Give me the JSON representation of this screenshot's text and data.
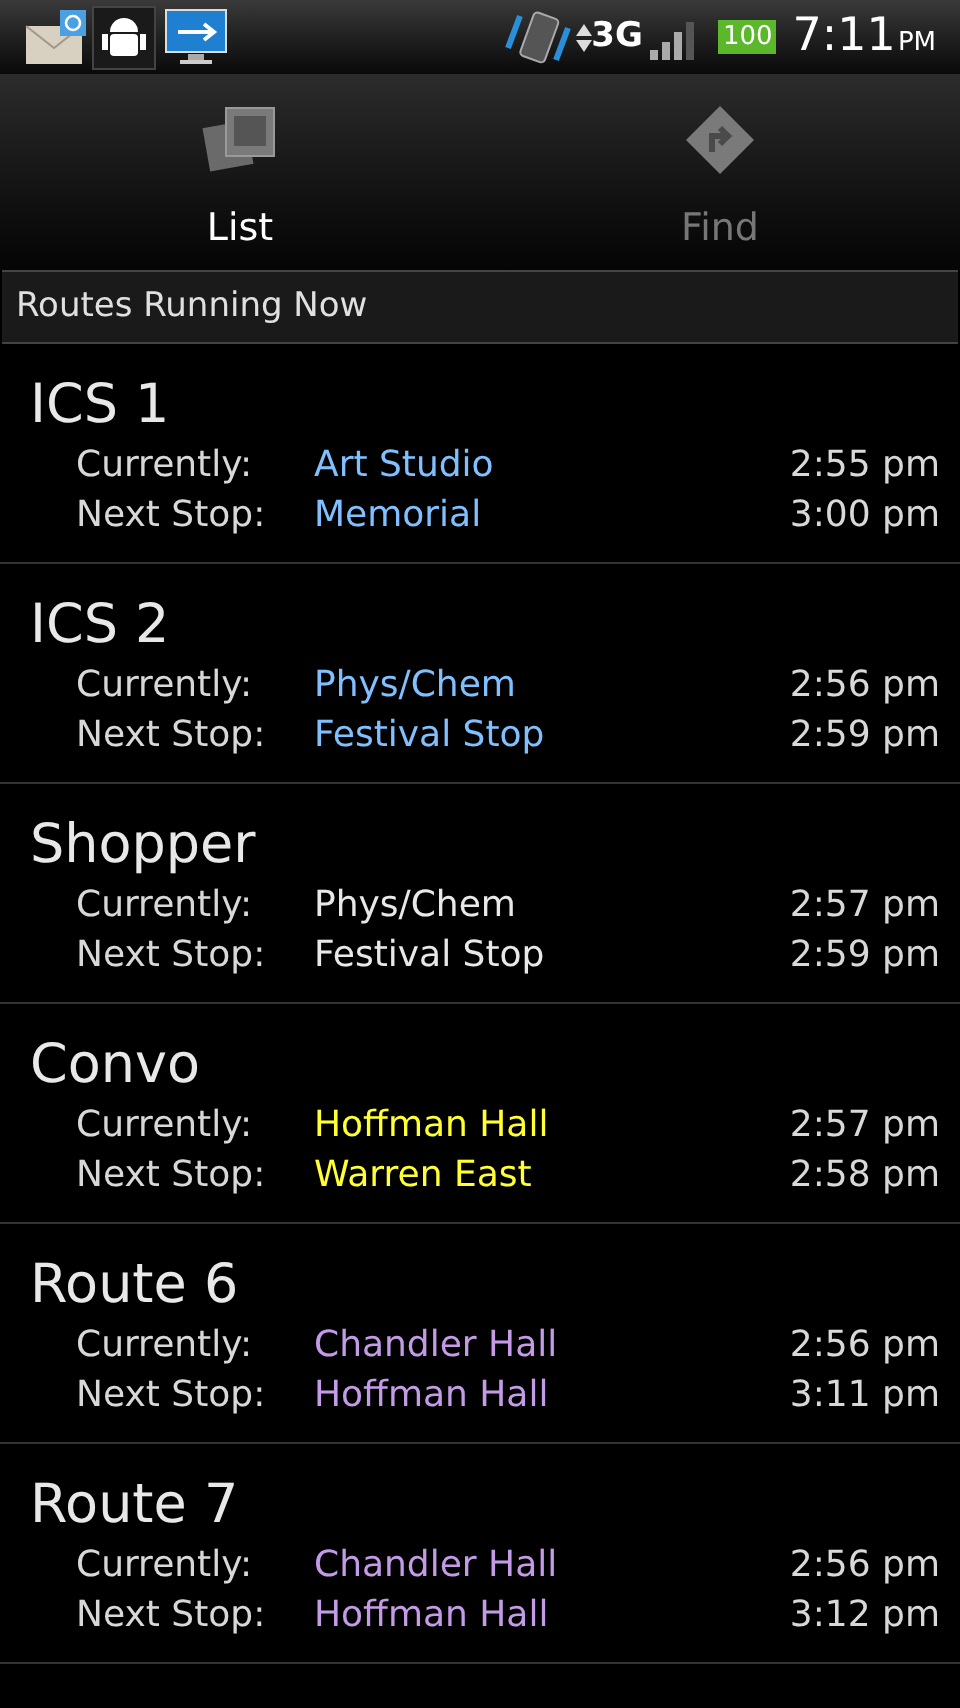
{
  "status_bar": {
    "network": "3G",
    "battery": "100",
    "time": "7:11",
    "ampm": "PM"
  },
  "tabs": [
    {
      "label": "List",
      "selected": true
    },
    {
      "label": "Find",
      "selected": false
    }
  ],
  "section_title": "Routes Running Now",
  "routes": [
    {
      "name": "ICS 1",
      "color": "#80c0ff",
      "current_label": "Currently:",
      "current_stop": "Art Studio",
      "current_time": "2:55 pm",
      "next_label": "Next Stop:",
      "next_stop": "Memorial",
      "next_time": "3:00 pm"
    },
    {
      "name": "ICS 2",
      "color": "#80c0ff",
      "current_label": "Currently:",
      "current_stop": "Phys/Chem",
      "current_time": "2:56 pm",
      "next_label": "Next Stop:",
      "next_stop": "Festival Stop",
      "next_time": "2:59 pm"
    },
    {
      "name": "Shopper",
      "color": "#e8e8e8",
      "current_label": "Currently:",
      "current_stop": "Phys/Chem",
      "current_time": "2:57 pm",
      "next_label": "Next Stop:",
      "next_stop": "Festival Stop",
      "next_time": "2:59 pm"
    },
    {
      "name": "Convo",
      "color": "#ffff33",
      "current_label": "Currently:",
      "current_stop": "Hoffman Hall",
      "current_time": "2:57 pm",
      "next_label": "Next Stop:",
      "next_stop": "Warren East",
      "next_time": "2:58 pm"
    },
    {
      "name": "Route 6",
      "color": "#c39be6",
      "current_label": "Currently:",
      "current_stop": "Chandler Hall",
      "current_time": "2:56 pm",
      "next_label": "Next Stop:",
      "next_stop": "Hoffman Hall",
      "next_time": "3:11 pm"
    },
    {
      "name": "Route 7",
      "color": "#c39be6",
      "current_label": "Currently:",
      "current_stop": "Chandler Hall",
      "current_time": "2:56 pm",
      "next_label": "Next Stop:",
      "next_stop": "Hoffman Hall",
      "next_time": "3:12 pm"
    }
  ]
}
